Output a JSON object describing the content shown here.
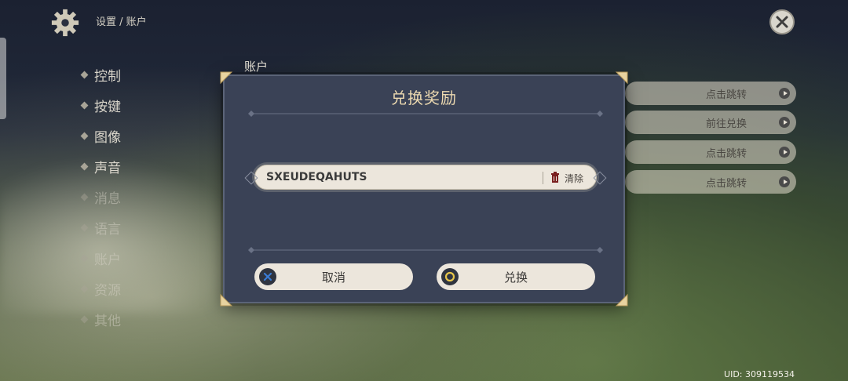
{
  "header": {
    "breadcrumb": "设置 / 账户",
    "close_icon": "close-icon",
    "gear_icon": "gear-icon"
  },
  "sidebar": {
    "items": [
      {
        "label": "控制"
      },
      {
        "label": "按键"
      },
      {
        "label": "图像"
      },
      {
        "label": "声音"
      },
      {
        "label": "消息"
      },
      {
        "label": "语言"
      },
      {
        "label": "账户"
      },
      {
        "label": "资源"
      },
      {
        "label": "其他"
      }
    ]
  },
  "main": {
    "section_title": "账户",
    "buttons": [
      {
        "label": "点击跳转"
      },
      {
        "label": "前往兑换"
      },
      {
        "label": "点击跳转"
      },
      {
        "label": "点击跳转"
      }
    ]
  },
  "dialog": {
    "title": "兑换奖励",
    "code_value": "SXEUDEQAHUTS",
    "clear_label": "清除",
    "cancel_label": "取消",
    "confirm_label": "兑换"
  },
  "footer": {
    "uid": "UID: 309119534"
  },
  "colors": {
    "dialog_bg": "#3a4256",
    "title_gold": "#ecd9b0",
    "button_cream": "#ece6dc",
    "cancel_badge": "#3a7bd5",
    "confirm_badge": "#e8c64a"
  }
}
